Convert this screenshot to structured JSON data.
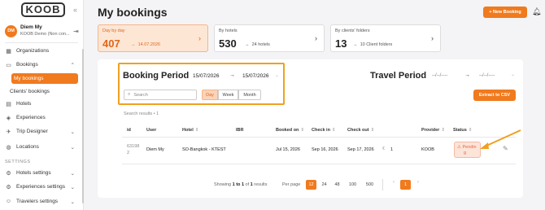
{
  "sidebar": {
    "logo": "KOOB",
    "collapse_icon": "double-chevron-left",
    "user": {
      "initials": "DM",
      "name": "Diem My",
      "org": "KOOB Demo (Non con..."
    },
    "items": [
      {
        "label": "Organizations",
        "icon": "building-icon"
      },
      {
        "label": "Bookings",
        "icon": "briefcase-icon"
      },
      {
        "label": "My bookings",
        "active": true
      },
      {
        "label": "Clients' bookings"
      },
      {
        "label": "Hotels",
        "icon": "hotel-icon"
      },
      {
        "label": "Experiences",
        "icon": "experience-icon"
      },
      {
        "label": "Trip Designer",
        "icon": "trip-icon"
      },
      {
        "label": "Locations",
        "icon": "globe-icon"
      }
    ],
    "settings_label": "SETTINGS",
    "settings_items": [
      {
        "label": "Hotels settings"
      },
      {
        "label": "Experiences settings"
      },
      {
        "label": "Travelers settings"
      }
    ]
  },
  "header": {
    "title": "My bookings",
    "new_booking": "+ New Booking"
  },
  "cards": [
    {
      "title": "Day by day",
      "value": "407",
      "sub": "14.07.2026",
      "highlighted": true
    },
    {
      "title": "By hotels",
      "value": "530",
      "sub": "24 hotels"
    },
    {
      "title": "By clients' folders",
      "value": "13",
      "sub": "10 Client folders"
    }
  ],
  "booking_period": {
    "title": "Booking Period",
    "from": "15/07/2026",
    "to": "15/07/2026",
    "search_placeholder": "Search",
    "segments": [
      "Day",
      "Week",
      "Month"
    ],
    "active_segment": "Day"
  },
  "travel_period": {
    "title": "Travel Period",
    "from": "--/--/----",
    "to": "--/--/----"
  },
  "extract_btn": "Extract to CSV",
  "results_label": "Search results • 1",
  "table": {
    "headers": [
      "id",
      "User",
      "Hotel",
      "IBR",
      "Booked on",
      "Check in",
      "Check out",
      "Provider",
      "Status"
    ],
    "row": {
      "id_1": "63198",
      "id_2": "2",
      "user": "Diem My",
      "hotel": "SO-Bangkok - KTEST",
      "ibr": "",
      "booked_on": "Jul 15, 2026",
      "check_in": "Sep 16, 2026",
      "check_out": "Sep 17, 2026",
      "nights": "1",
      "provider": "KOOB",
      "status_1": "Pendin",
      "status_2": "g"
    }
  },
  "pagination": {
    "showing_prefix": "Showing",
    "range": "1 to 1",
    "of": "of",
    "total": "1",
    "results": "results",
    "per_page_label": "Per page",
    "per_page": [
      "12",
      "24",
      "48",
      "100",
      "500"
    ],
    "current_page": "1"
  },
  "colors": {
    "accent": "#f07a1e",
    "highlight_box": "#f0a020"
  }
}
